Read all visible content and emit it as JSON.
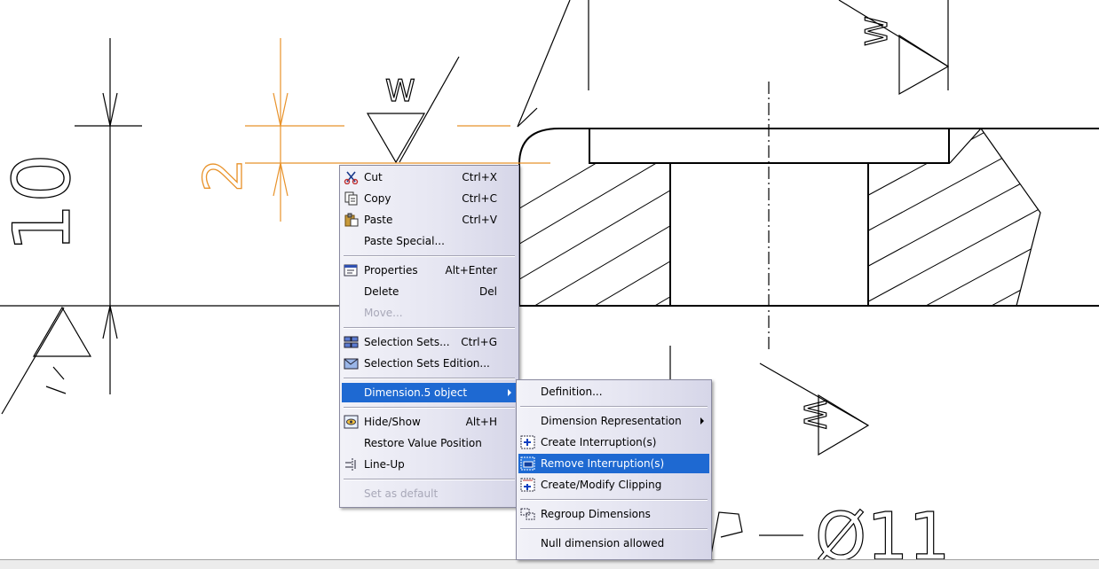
{
  "drawing": {
    "line_color": "#000000",
    "highlight_color": "#e8922a",
    "labels": {
      "height_10": "10",
      "height_2": "2",
      "weld_w1": "W",
      "weld_w2": "W",
      "weld_w3": "W",
      "diameter": "Ø11"
    }
  },
  "context_menu": {
    "items": [
      {
        "label": "Cut",
        "shortcut": "Ctrl+X",
        "icon": "scissors-icon"
      },
      {
        "label": "Copy",
        "shortcut": "Ctrl+C",
        "icon": "copy-icon"
      },
      {
        "label": "Paste",
        "shortcut": "Ctrl+V",
        "icon": "paste-icon"
      },
      {
        "label": "Paste Special...",
        "shortcut": ""
      },
      {
        "label": "Properties",
        "shortcut": "Alt+Enter",
        "icon": "properties-icon"
      },
      {
        "label": "Delete",
        "shortcut": "Del"
      },
      {
        "label": "Move...",
        "shortcut": "",
        "disabled": true
      },
      {
        "label": "Selection Sets...",
        "shortcut": "Ctrl+G",
        "icon": "selection-sets-icon"
      },
      {
        "label": "Selection Sets Edition...",
        "shortcut": "",
        "icon": "selection-sets-edition-icon"
      },
      {
        "label": "Dimension.5 object",
        "shortcut": "",
        "submenu": true,
        "highlighted": true
      },
      {
        "label": "Hide/Show",
        "shortcut": "Alt+H",
        "icon": "hide-show-icon"
      },
      {
        "label": "Restore Value Position",
        "shortcut": ""
      },
      {
        "label": "Line-Up",
        "shortcut": "",
        "icon": "line-up-icon"
      },
      {
        "label": "Set as default",
        "shortcut": "",
        "disabled": true
      }
    ]
  },
  "submenu": {
    "items": [
      {
        "label": "Definition..."
      },
      {
        "label": "Dimension Representation",
        "submenu": true
      },
      {
        "label": "Create Interruption(s)",
        "icon": "create-interruption-icon"
      },
      {
        "label": "Remove Interruption(s)",
        "icon": "remove-interruption-icon",
        "highlighted": true
      },
      {
        "label": "Create/Modify Clipping",
        "icon": "clipping-icon"
      },
      {
        "label": "Regroup Dimensions",
        "icon": "regroup-icon"
      },
      {
        "label": "Null dimension allowed"
      }
    ]
  },
  "accent_color": "#1e69d2"
}
